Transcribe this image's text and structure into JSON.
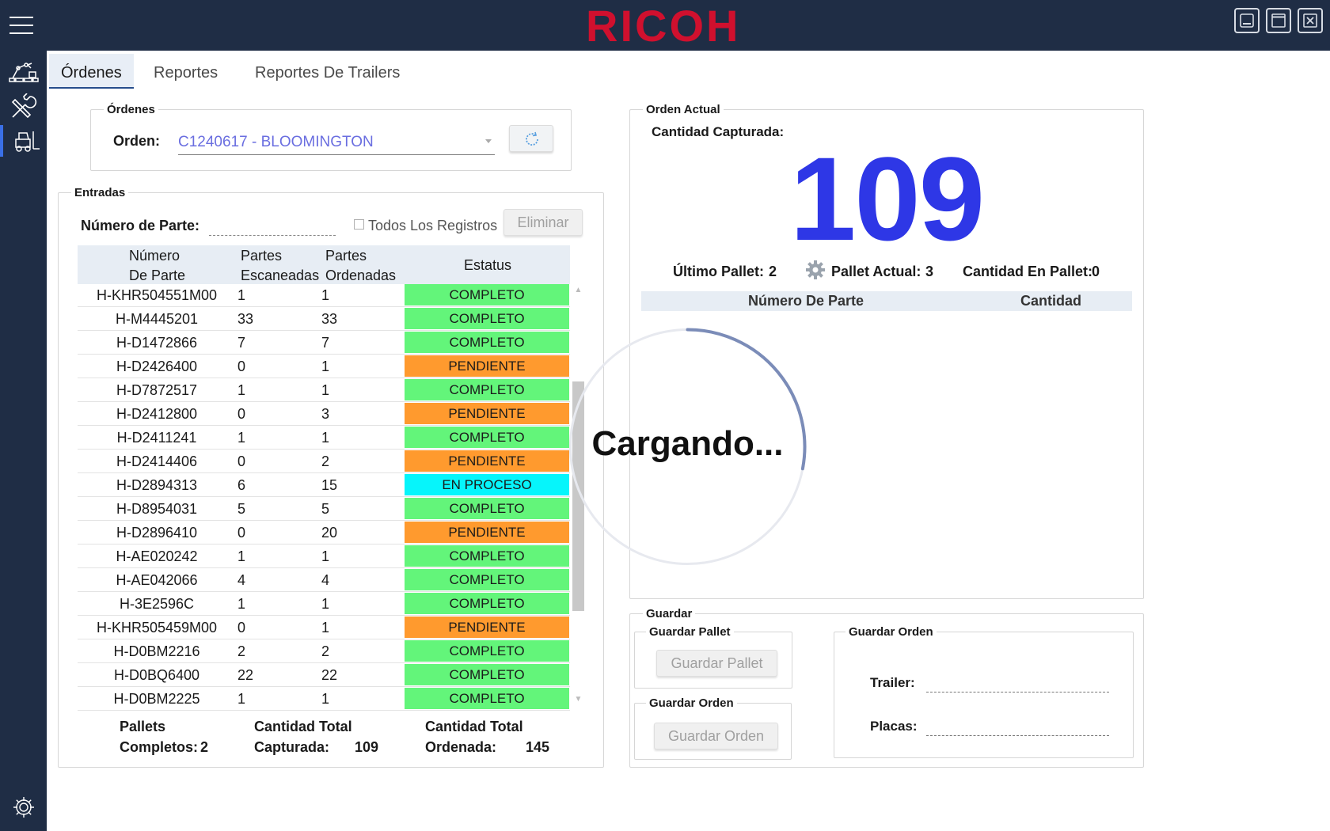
{
  "app": {
    "logo_text": "RICOH",
    "brand_color": "#d0102e"
  },
  "window_controls": [
    "minimize-icon",
    "maximize-icon",
    "close-icon"
  ],
  "sidebar": {
    "items": [
      {
        "icon": "robot-arm-icon"
      },
      {
        "icon": "wrench-icon"
      },
      {
        "icon": "forklift-icon",
        "active": true
      }
    ],
    "bottom_icon": "gear-icon"
  },
  "tabs": [
    {
      "label": "Órdenes",
      "active": true
    },
    {
      "label": "Reportes"
    },
    {
      "label": "Reportes De Trailers"
    }
  ],
  "ordenes_group": {
    "legend": "Órdenes",
    "orden_label": "Orden:",
    "orden_value": "C1240617 - BLOOMINGTON"
  },
  "entradas": {
    "legend": "Entradas",
    "numero_parte_label": "Número de Parte:",
    "numero_parte_value": "",
    "todos_label": "Todos Los Registros",
    "eliminar_label": "Eliminar",
    "columns": [
      "Número De Parte",
      "Partes Escaneadas",
      "Partes Ordenadas",
      "Estatus"
    ],
    "column_lines": [
      [
        "Número",
        "De Parte"
      ],
      [
        "Partes",
        "Escaneadas"
      ],
      [
        "Partes",
        "Ordenadas"
      ],
      [
        "Estatus"
      ]
    ],
    "status_colors": {
      "COMPLETO": "#63f57a",
      "PENDIENTE": "#ff9a2e",
      "EN PROCESO": "#06f5fb"
    },
    "rows": [
      {
        "parte": "H-KHR504551M00",
        "escaneadas": "1",
        "ordenadas": "1",
        "estatus": "COMPLETO"
      },
      {
        "parte": "H-M4445201",
        "escaneadas": "33",
        "ordenadas": "33",
        "estatus": "COMPLETO"
      },
      {
        "parte": "H-D1472866",
        "escaneadas": "7",
        "ordenadas": "7",
        "estatus": "COMPLETO"
      },
      {
        "parte": "H-D2426400",
        "escaneadas": "0",
        "ordenadas": "1",
        "estatus": "PENDIENTE"
      },
      {
        "parte": "H-D7872517",
        "escaneadas": "1",
        "ordenadas": "1",
        "estatus": "COMPLETO"
      },
      {
        "parte": "H-D2412800",
        "escaneadas": "0",
        "ordenadas": "3",
        "estatus": "PENDIENTE"
      },
      {
        "parte": "H-D2411241",
        "escaneadas": "1",
        "ordenadas": "1",
        "estatus": "COMPLETO"
      },
      {
        "parte": "H-D2414406",
        "escaneadas": "0",
        "ordenadas": "2",
        "estatus": "PENDIENTE"
      },
      {
        "parte": "H-D2894313",
        "escaneadas": "6",
        "ordenadas": "15",
        "estatus": "EN PROCESO"
      },
      {
        "parte": "H-D8954031",
        "escaneadas": "5",
        "ordenadas": "5",
        "estatus": "COMPLETO"
      },
      {
        "parte": "H-D2896410",
        "escaneadas": "0",
        "ordenadas": "20",
        "estatus": "PENDIENTE"
      },
      {
        "parte": "H-AE020242",
        "escaneadas": "1",
        "ordenadas": "1",
        "estatus": "COMPLETO"
      },
      {
        "parte": "H-AE042066",
        "escaneadas": "4",
        "ordenadas": "4",
        "estatus": "COMPLETO"
      },
      {
        "parte": "H-3E2596C",
        "escaneadas": "1",
        "ordenadas": "1",
        "estatus": "COMPLETO"
      },
      {
        "parte": "H-KHR505459M00",
        "escaneadas": "0",
        "ordenadas": "1",
        "estatus": "PENDIENTE"
      },
      {
        "parte": "H-D0BM2216",
        "escaneadas": "2",
        "ordenadas": "2",
        "estatus": "COMPLETO"
      },
      {
        "parte": "H-D0BQ6400",
        "escaneadas": "22",
        "ordenadas": "22",
        "estatus": "COMPLETO"
      },
      {
        "parte": "H-D0BM2225",
        "escaneadas": "1",
        "ordenadas": "1",
        "estatus": "COMPLETO"
      }
    ],
    "totals": {
      "pallets_line1": "Pallets",
      "pallets_line2": "Completos:",
      "pallets_value": "2",
      "capturada_line1": "Cantidad Total",
      "capturada_line2": "Capturada:",
      "capturada_value": "109",
      "ordenada_line1": "Cantidad Total",
      "ordenada_line2": "Ordenada:",
      "ordenada_value": "145"
    }
  },
  "orden_actual": {
    "legend": "Orden Actual",
    "cantidad_label": "Cantidad Capturada:",
    "cantidad_value": "109",
    "ultimo_pallet_label": "Último Pallet:",
    "ultimo_pallet_value": "2",
    "pallet_actual_label": "Pallet Actual:",
    "pallet_actual_value": "3",
    "cantidad_pallet_label": "Cantidad En Pallet:",
    "cantidad_pallet_value": "0",
    "columns": [
      "Número De Parte",
      "Cantidad"
    ]
  },
  "loading": {
    "text": "Cargando...",
    "progress": 0.28
  },
  "guardar": {
    "legend": "Guardar",
    "pallet_legend": "Guardar Pallet",
    "pallet_button": "Guardar Pallet",
    "orden_small_legend": "Guardar Orden",
    "orden_button": "Guardar Orden",
    "orden_legend": "Guardar Orden",
    "trailer_label": "Trailer:",
    "trailer_value": "",
    "placas_label": "Placas:",
    "placas_value": ""
  }
}
